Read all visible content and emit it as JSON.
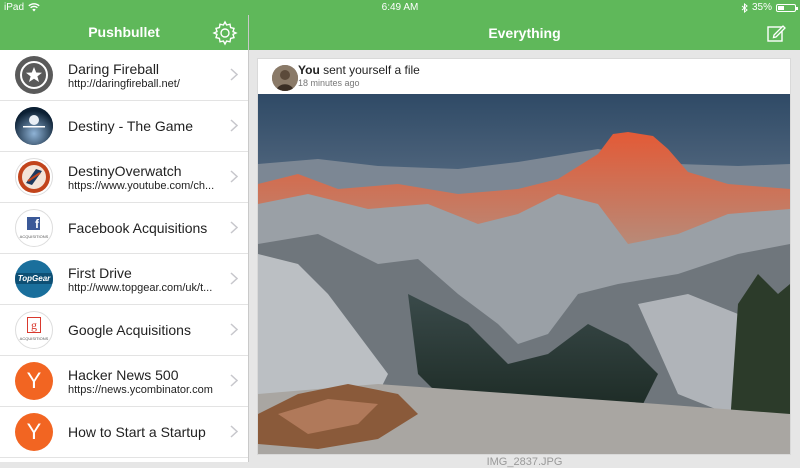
{
  "statusbar": {
    "device": "iPad",
    "time": "6:49 AM",
    "battery": "35%",
    "battery_level": 0.35
  },
  "sidebar": {
    "title": "Pushbullet",
    "items": [
      {
        "name": "Daring Fireball",
        "url": "http://daringfireball.net/",
        "icon": "star-icon",
        "color": "#5a5a5a"
      },
      {
        "name": "Destiny - The Game",
        "url": "",
        "icon": "destiny-icon",
        "color": "#0b1f33"
      },
      {
        "name": "DestinyOverwatch",
        "url": "https://www.youtube.com/ch...",
        "icon": "overwatch-icon",
        "color": "#c2441c"
      },
      {
        "name": "Facebook Acquisitions",
        "url": "",
        "icon": "facebook-icon",
        "color": "#3b5998"
      },
      {
        "name": "First Drive",
        "url": "http://www.topgear.com/uk/t...",
        "icon": "topgear-icon",
        "color": "#1a6f9c"
      },
      {
        "name": "Google Acquisitions",
        "url": "",
        "icon": "google-icon",
        "color": "#d9392e"
      },
      {
        "name": "Hacker News 500",
        "url": "https://news.ycombinator.com",
        "icon": "y-icon",
        "color": "#f26522"
      },
      {
        "name": "How to Start a Startup",
        "url": "",
        "icon": "y-icon",
        "color": "#f26522"
      }
    ],
    "acquisitions_label": "ACQUISITIONS",
    "topgear_label": "TopGear",
    "y_label": "Y",
    "fb_label": "f",
    "g_label": "g"
  },
  "main": {
    "title": "Everything",
    "card": {
      "sender": "You",
      "action": " sent yourself a file",
      "time_ago": "18 minutes ago"
    },
    "caption": "IMG_2837.JPG"
  },
  "colors": {
    "accent": "#5fb85a"
  }
}
